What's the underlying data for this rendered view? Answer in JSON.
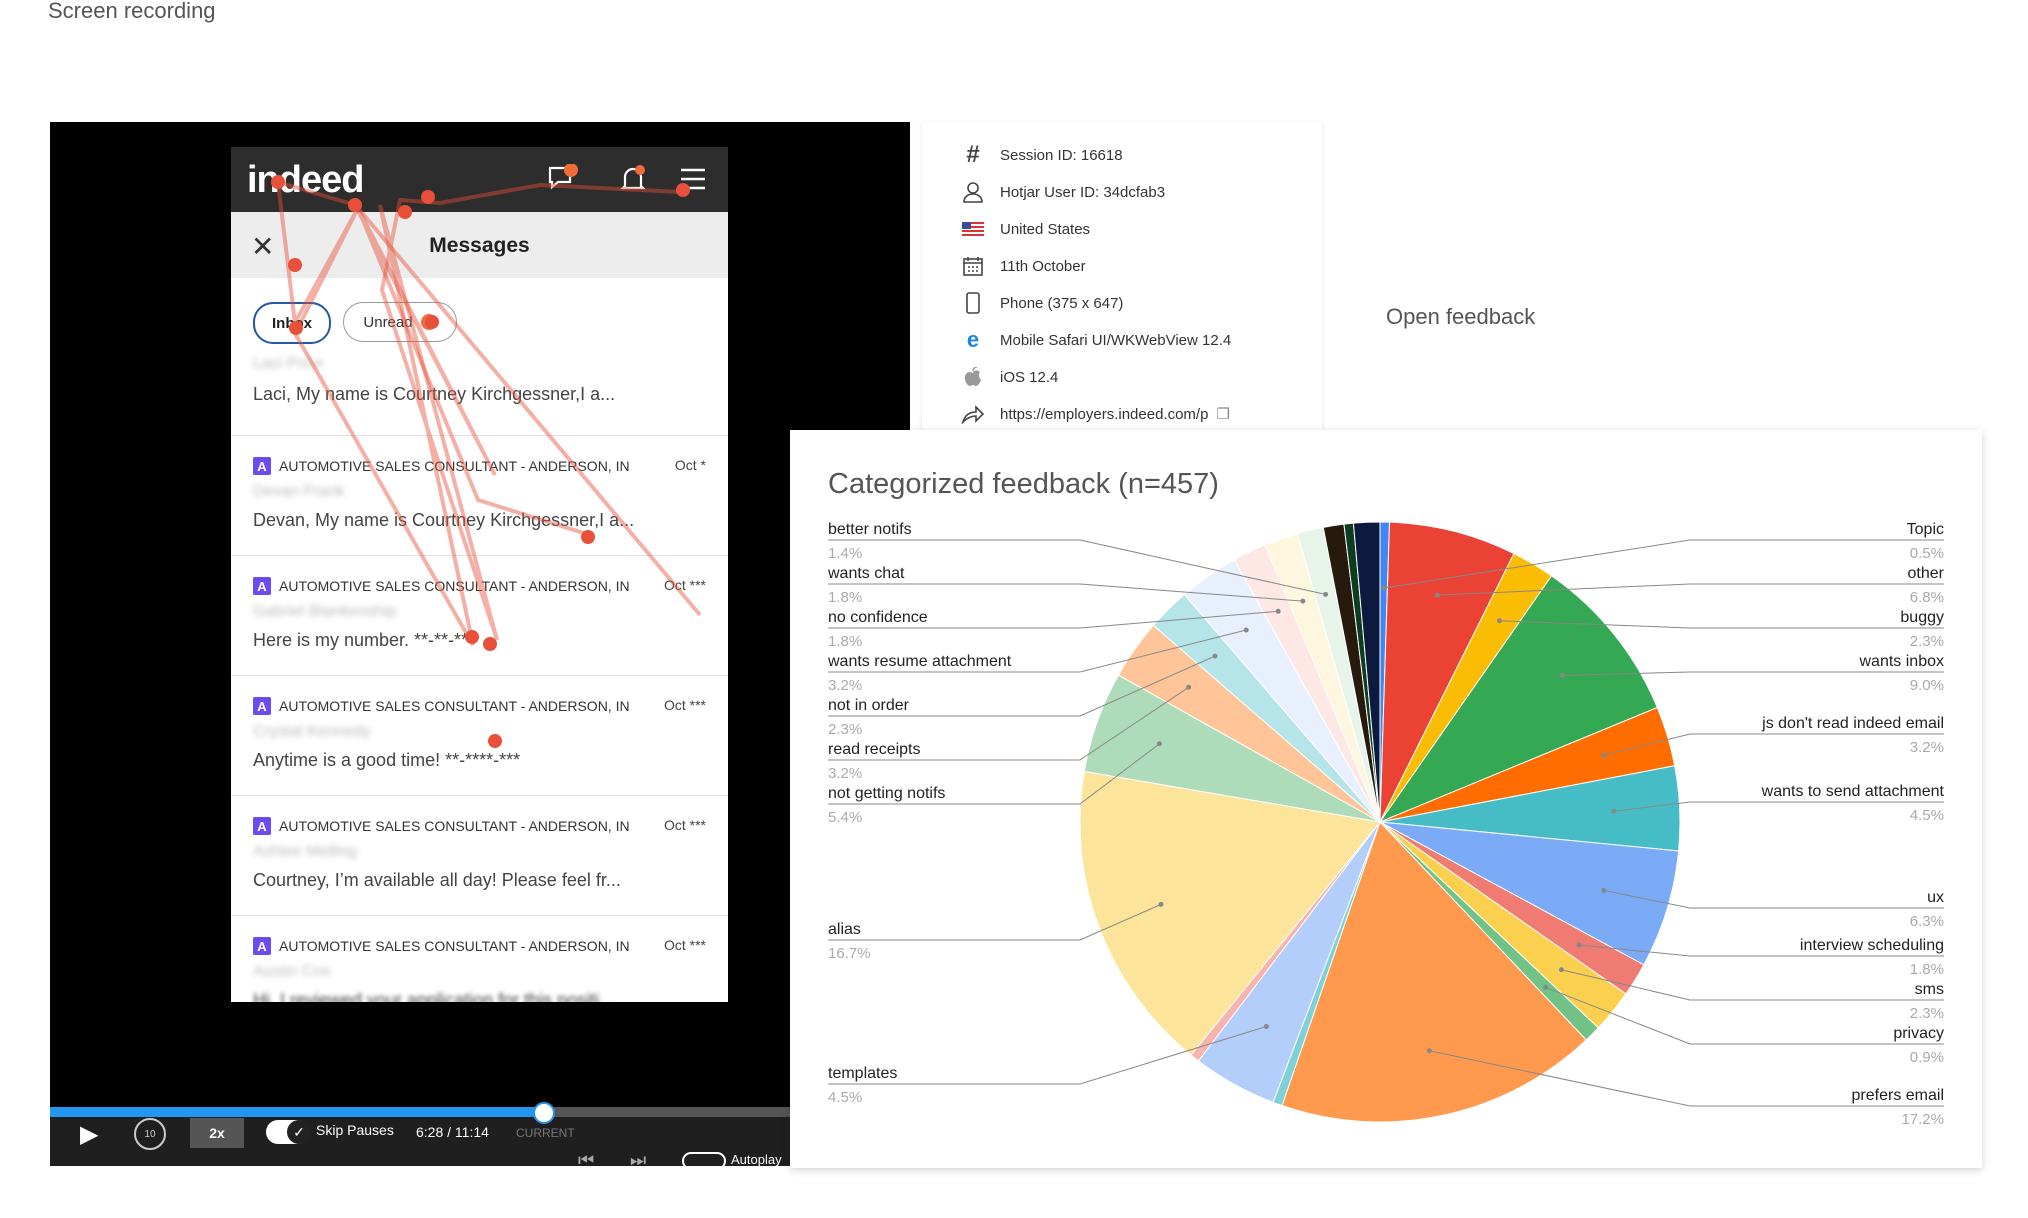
{
  "page": {
    "screen_recording_label": "Screen recording",
    "open_feedback_label": "Open feedback"
  },
  "phone": {
    "logo": "indeed",
    "messages_title": "Messages",
    "tabs": [
      {
        "label": "Inbox"
      },
      {
        "label": "Unread"
      }
    ],
    "messages": [
      {
        "job": "",
        "name": "Laci Price",
        "text": "Laci, My name is Courtney Kirchgessner,I a...",
        "date": ""
      },
      {
        "job": "AUTOMOTIVE SALES CONSULTANT - ANDERSON, IN",
        "name": "Devan Frank",
        "text": "Devan, My name is Courtney Kirchgessner,I a...",
        "date": "Oct *"
      },
      {
        "job": "AUTOMOTIVE SALES CONSULTANT - ANDERSON, IN",
        "name": "Gabriel Blankenship",
        "text": "Here is my number. **-**-**",
        "date": "Oct ***"
      },
      {
        "job": "AUTOMOTIVE SALES CONSULTANT - ANDERSON, IN",
        "name": "Crystal Kennedy",
        "text": "Anytime is a good time! **-****-***",
        "date": "Oct ***"
      },
      {
        "job": "AUTOMOTIVE SALES CONSULTANT - ANDERSON, IN",
        "name": "Ashlee Melling",
        "text": "Courtney, I’m available all day! Please feel fr...",
        "date": "Oct ***"
      },
      {
        "job": "AUTOMOTIVE SALES CONSULTANT - ANDERSON, IN",
        "name": "Austin Cox",
        "text": "Hi, I reviewed your application for this positi...",
        "date": "Oct ***"
      }
    ]
  },
  "player": {
    "speed": "2x",
    "skip_pauses": "Skip Pauses",
    "time": "6:28 / 11:14",
    "current": "CURRENT",
    "autoplay": "Autoplay",
    "rewind_seconds": "10",
    "progress_fraction": 0.57
  },
  "session": {
    "rows": [
      {
        "icon": "hash-icon",
        "text": "Session ID: 16618"
      },
      {
        "icon": "user-icon",
        "text": "Hotjar User ID: 34dcfab3"
      },
      {
        "icon": "us-flag-icon",
        "text": "United States"
      },
      {
        "icon": "calendar-icon",
        "text": "11th October"
      },
      {
        "icon": "phone-icon",
        "text": "Phone (375 x 647)"
      },
      {
        "icon": "browser-icon",
        "text": "Mobile Safari UI/WKWebView 12.4"
      },
      {
        "icon": "apple-icon",
        "text": "iOS 12.4"
      },
      {
        "icon": "share-icon",
        "text": "https://employers.indeed.com/p"
      }
    ]
  },
  "chart_data": {
    "type": "pie",
    "title": "Categorized feedback (n=457)",
    "slices": [
      {
        "label": "Topic",
        "value": 0.5,
        "pct": "0.5%",
        "color": "#4285f4"
      },
      {
        "label": "other",
        "value": 6.8,
        "pct": "6.8%",
        "color": "#ea4335"
      },
      {
        "label": "buggy",
        "value": 2.3,
        "pct": "2.3%",
        "color": "#fbbc04"
      },
      {
        "label": "wants inbox",
        "value": 9.0,
        "pct": "9.0%",
        "color": "#34a853"
      },
      {
        "label": "js don't read indeed email",
        "value": 3.2,
        "pct": "3.2%",
        "color": "#ff6d01"
      },
      {
        "label": "wants to send attachment",
        "value": 4.5,
        "pct": "4.5%",
        "color": "#46bdc6"
      },
      {
        "label": "ux",
        "value": 6.3,
        "pct": "6.3%",
        "color": "#7baaf7"
      },
      {
        "label": "interview scheduling",
        "value": 1.8,
        "pct": "1.8%",
        "color": "#f07b72"
      },
      {
        "label": "sms",
        "value": 2.3,
        "pct": "2.3%",
        "color": "#fcd04f"
      },
      {
        "label": "privacy",
        "value": 0.9,
        "pct": "0.9%",
        "color": "#71c287"
      },
      {
        "label": "prefers email",
        "value": 17.2,
        "pct": "17.2%",
        "color": "#ff994d"
      },
      {
        "label": "",
        "value": 0.5,
        "pct": "",
        "color": "#7ed1d7"
      },
      {
        "label": "templates",
        "value": 4.5,
        "pct": "4.5%",
        "color": "#b3cefb"
      },
      {
        "label": "",
        "value": 0.5,
        "pct": "",
        "color": "#f7b4ae"
      },
      {
        "label": "alias",
        "value": 16.7,
        "pct": "16.7%",
        "color": "#fde49b"
      },
      {
        "label": "not getting notifs",
        "value": 5.4,
        "pct": "5.4%",
        "color": "#aedcba"
      },
      {
        "label": "read receipts",
        "value": 3.2,
        "pct": "3.2%",
        "color": "#ffc599"
      },
      {
        "label": "not in order",
        "value": 2.3,
        "pct": "2.3%",
        "color": "#b5e5e8"
      },
      {
        "label": "wants resume attachment",
        "value": 3.2,
        "pct": "3.2%",
        "color": "#e8f0fe"
      },
      {
        "label": "no confidence",
        "value": 1.8,
        "pct": "1.8%",
        "color": "#fde8e6"
      },
      {
        "label": "wants chat",
        "value": 1.8,
        "pct": "1.8%",
        "color": "#fef7e0"
      },
      {
        "label": "better notifs",
        "value": 1.4,
        "pct": "1.4%",
        "color": "#e6f4ea"
      },
      {
        "label": "",
        "value": 1.1,
        "pct": "",
        "color": "#271a0c"
      },
      {
        "label": "",
        "value": 0.5,
        "pct": "",
        "color": "#0b3d1e"
      },
      {
        "label": "",
        "value": 1.4,
        "pct": "",
        "color": "#0b1a3d"
      }
    ],
    "legend_left": [
      "better notifs",
      "wants chat",
      "no confidence",
      "wants resume attachment",
      "not in order",
      "read receipts",
      "not getting notifs",
      "alias",
      "templates"
    ],
    "legend_right": [
      "Topic",
      "other",
      "buggy",
      "wants inbox",
      "js don't read indeed email",
      "wants to send attachment",
      "ux",
      "interview scheduling",
      "sms",
      "privacy",
      "prefers email"
    ]
  }
}
